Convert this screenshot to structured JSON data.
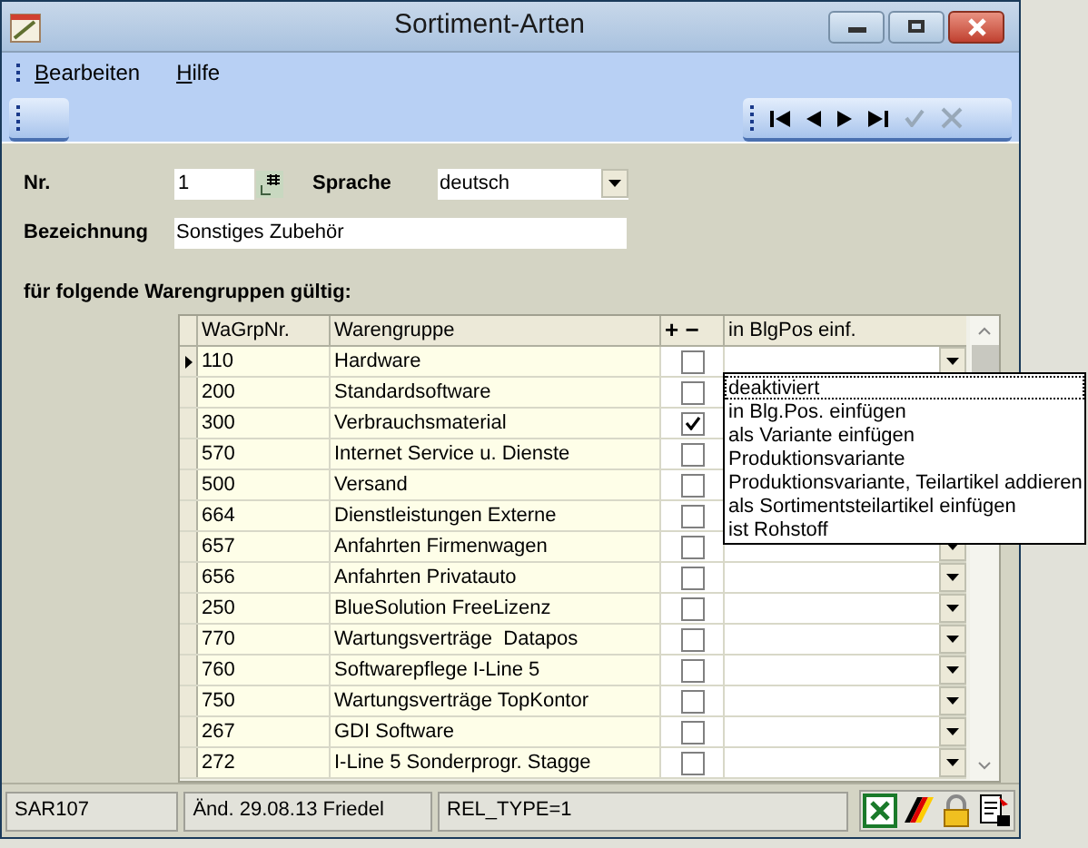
{
  "window": {
    "title": "Sortiment-Arten"
  },
  "menu": [
    {
      "label": "Bearbeiten"
    },
    {
      "label": "Hilfe"
    }
  ],
  "form": {
    "nr_label": "Nr.",
    "nr_value": "1",
    "sprache_label": "Sprache",
    "sprache_value": "deutsch",
    "bezeichnung_label": "Bezeichnung",
    "bezeichnung_value": "Sonstiges Zubehör",
    "section_title": "für folgende Warengruppen gültig:"
  },
  "table": {
    "columns": [
      "WaGrpNr.",
      "Warengruppe",
      "+ −",
      "in BlgPos einf."
    ],
    "rows": [
      {
        "nr": "110",
        "name": "Hardware",
        "checked": false,
        "current": true
      },
      {
        "nr": "200",
        "name": "Standardsoftware",
        "checked": false,
        "current": false
      },
      {
        "nr": "300",
        "name": "Verbrauchsmaterial",
        "checked": true,
        "current": false
      },
      {
        "nr": "570",
        "name": "Internet Service u. Dienste",
        "checked": false,
        "current": false
      },
      {
        "nr": "500",
        "name": "Versand",
        "checked": false,
        "current": false
      },
      {
        "nr": "664",
        "name": "Dienstleistungen Externe",
        "checked": false,
        "current": false
      },
      {
        "nr": "657",
        "name": "Anfahrten Firmenwagen",
        "checked": false,
        "current": false
      },
      {
        "nr": "656",
        "name": "Anfahrten Privatauto",
        "checked": false,
        "current": false
      },
      {
        "nr": "250",
        "name": "BlueSolution FreeLizenz",
        "checked": false,
        "current": false
      },
      {
        "nr": "770",
        "name": "Wartungsverträge  Datapos",
        "checked": false,
        "current": false
      },
      {
        "nr": "760",
        "name": "Softwarepflege I-Line 5",
        "checked": false,
        "current": false
      },
      {
        "nr": "750",
        "name": "Wartungsverträge TopKontor",
        "checked": false,
        "current": false
      },
      {
        "nr": "267",
        "name": "GDI Software",
        "checked": false,
        "current": false
      },
      {
        "nr": "272",
        "name": "I-Line 5 Sonderprogr. Stagge",
        "checked": false,
        "current": false
      }
    ]
  },
  "dropdown_list": [
    {
      "label": "deaktiviert",
      "selected": true
    },
    {
      "label": "in Blg.Pos. einfügen",
      "selected": false
    },
    {
      "label": "als Variante einfügen",
      "selected": false
    },
    {
      "label": "Produktionsvariante",
      "selected": false
    },
    {
      "label": "Produktionsvariante, Teilartikel addieren",
      "selected": false
    },
    {
      "label": "als Sortimentsteilartikel einfügen",
      "selected": false
    },
    {
      "label": "ist Rohstoff",
      "selected": false
    }
  ],
  "status_bar": [
    "SAR107",
    "Änd. 29.08.13 Friedel",
    "REL_TYPE=1"
  ]
}
